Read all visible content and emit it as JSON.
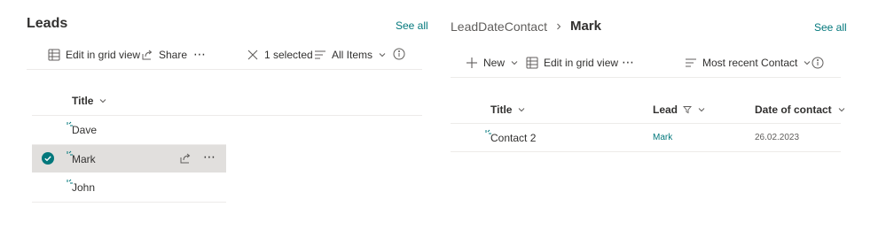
{
  "left": {
    "title": "Leads",
    "see_all": "See all",
    "toolbar": {
      "edit_grid": "Edit in grid view",
      "share": "Share",
      "selected": "1 selected",
      "view": "All Items"
    },
    "column_title": "Title",
    "rows": [
      {
        "title": "Dave"
      },
      {
        "title": "Mark"
      },
      {
        "title": "John"
      }
    ]
  },
  "right": {
    "breadcrumb_parent": "LeadDateContact",
    "breadcrumb_current": "Mark",
    "see_all": "See all",
    "toolbar": {
      "new": "New",
      "edit_grid": "Edit in grid view",
      "view": "Most recent Contact"
    },
    "columns": {
      "title": "Title",
      "lead": "Lead",
      "date": "Date of contact"
    },
    "rows": [
      {
        "title": "Contact 2",
        "lead": "Mark",
        "date": "26.02.2023"
      }
    ]
  },
  "colors": {
    "accent": "#03787c",
    "selected_row": "#e1dfdd",
    "check": "#03787c"
  }
}
